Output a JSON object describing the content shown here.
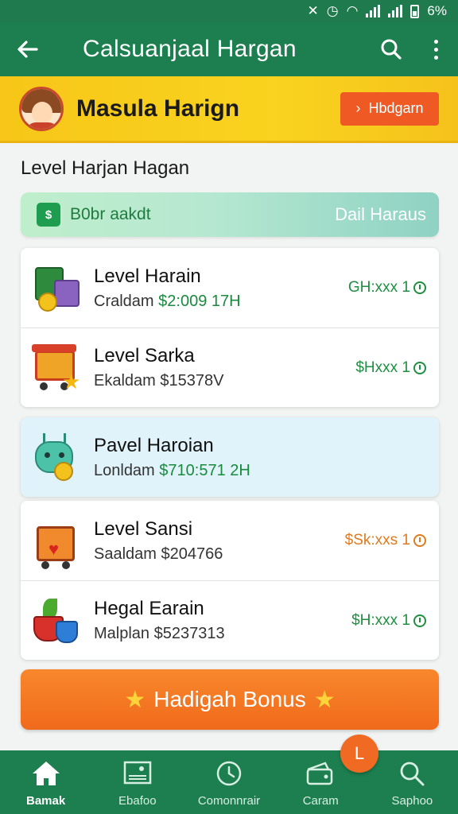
{
  "status_bar": {
    "battery": "6%"
  },
  "app_bar": {
    "title": "Calsuanjaal Hargan"
  },
  "promo": {
    "title": "Masula  Harign",
    "button_label": "Hbdgarn"
  },
  "section": {
    "title": "Level Harjan Hagan"
  },
  "filter": {
    "label": "B0br aakdt",
    "right_label": "Dail Haraus"
  },
  "items": [
    {
      "name": "Level Harain",
      "sub_label": "Craldam",
      "value": "$2:009 17H",
      "rate": "GH:xxx 1"
    },
    {
      "name": "Level Sarka",
      "sub_label": "Ekaldam",
      "value": "$15378V",
      "rate": "$Hxxx 1"
    },
    {
      "name": "Pavel Haroian",
      "sub_label": "Lonldam",
      "value": "$710:571 2H",
      "rate": ""
    },
    {
      "name": "Level Sansi",
      "sub_label": "Saaldam",
      "value": "$204766",
      "rate": "$Sk:xxs 1"
    },
    {
      "name": "Hegal Earain",
      "sub_label": "Malplan",
      "value": "$5237313",
      "rate": "$H:xxx 1"
    }
  ],
  "bonus": {
    "label": "Hadigah Bonus"
  },
  "bottom_nav": [
    {
      "label": "Bamak",
      "icon": "home-icon"
    },
    {
      "label": "Ebafoo",
      "icon": "picture-icon"
    },
    {
      "label": "Comonnrair",
      "icon": "clock-icon"
    },
    {
      "label": "Caram",
      "icon": "wallet-icon"
    },
    {
      "label": "Saphoo",
      "icon": "search-icon"
    }
  ],
  "fab": {
    "label": "L"
  },
  "colors": {
    "primary": "#1d7f4f",
    "accent": "#f06a1b",
    "promo": "#f7c618",
    "value_green": "#1a8a3e"
  }
}
